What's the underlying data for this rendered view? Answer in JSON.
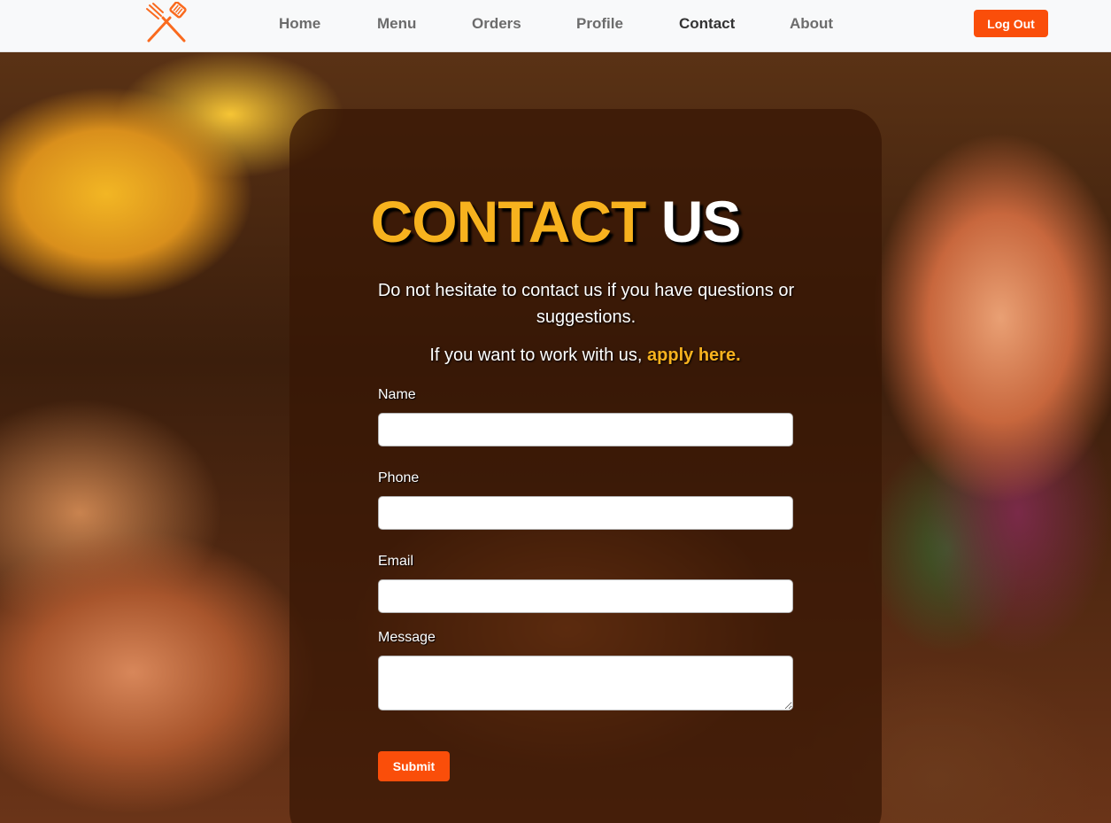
{
  "colors": {
    "accent": "#fa4e0a",
    "highlight": "#f7b21e",
    "nav_bg": "#f8f9fa"
  },
  "navbar": {
    "logo_icon": "grill-tools-icon",
    "links": [
      {
        "label": "Home",
        "active": false
      },
      {
        "label": "Menu",
        "active": false
      },
      {
        "label": "Orders",
        "active": false
      },
      {
        "label": "Profile",
        "active": false
      },
      {
        "label": "Contact",
        "active": true
      },
      {
        "label": "About",
        "active": false
      }
    ],
    "logout_label": "Log Out"
  },
  "contact": {
    "title_part1": "CONTACT",
    "title_part2": "US",
    "subtitle": "Do not hesitate to contact us if you have questions or suggestions.",
    "apply_text": "If you want to work with us,",
    "apply_link": "apply here.",
    "form": {
      "name_label": "Name",
      "name_value": "",
      "phone_label": "Phone",
      "phone_value": "",
      "email_label": "Email",
      "email_value": "",
      "message_label": "Message",
      "message_value": "",
      "submit_label": "Submit"
    }
  }
}
